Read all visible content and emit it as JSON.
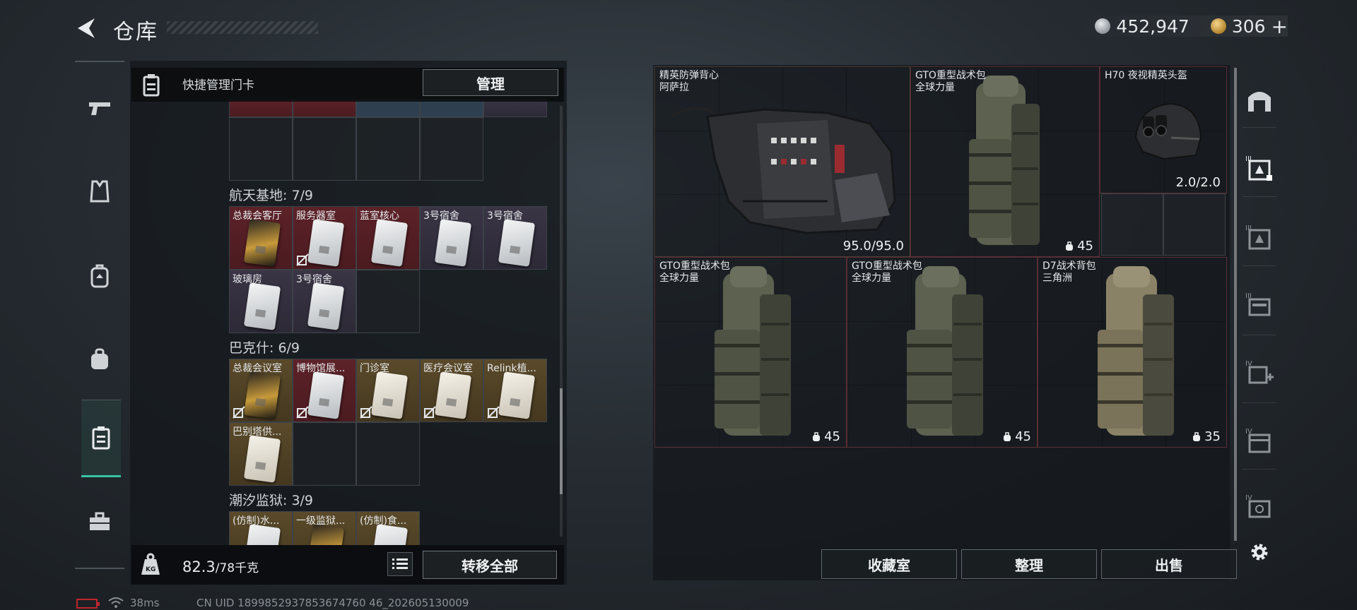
{
  "header": {
    "title": "仓库",
    "currency": [
      {
        "icon": "silver-coin-icon",
        "value": "452,947"
      },
      {
        "icon": "gold-coin-icon",
        "value": "306",
        "suffix": "+"
      }
    ]
  },
  "left_rail": {
    "items": [
      {
        "icon": "pistol-icon",
        "active": false
      },
      {
        "icon": "armor-vest-icon",
        "active": false
      },
      {
        "icon": "backpack-icon",
        "active": false
      },
      {
        "icon": "helmet-bag-icon",
        "active": false
      },
      {
        "icon": "keycard-holder-icon",
        "active": true
      },
      {
        "icon": "toolbox-icon",
        "active": false
      }
    ]
  },
  "left_panel": {
    "header_label": "快捷管理门卡",
    "manage_label": "管理",
    "sections": [
      {
        "title": "航天基地: 7/9",
        "cells": [
          {
            "label": "总裁会客厅",
            "color": "red",
            "card": "gold",
            "nolink": false
          },
          {
            "label": "服务器室",
            "color": "red",
            "card": "silver",
            "nolink": true
          },
          {
            "label": "蓝室核心",
            "color": "red",
            "card": "silver",
            "nolink": false
          },
          {
            "label": "3号宿舍",
            "color": "purple",
            "card": "silver",
            "nolink": false
          },
          {
            "label": "3号宿舍",
            "color": "purple",
            "card": "silver",
            "nolink": false
          },
          {
            "label": "玻璃房",
            "color": "purple",
            "card": "silver",
            "nolink": false
          },
          {
            "label": "3号宿舍",
            "color": "purple",
            "card": "silver",
            "nolink": false
          }
        ]
      },
      {
        "title": "巴克什: 6/9",
        "cells": [
          {
            "label": "总裁会议室",
            "color": "gold",
            "card": "gold",
            "nolink": true
          },
          {
            "label": "博物馆展...",
            "color": "red",
            "card": "silver",
            "nolink": true
          },
          {
            "label": "门诊室",
            "color": "gold",
            "card": "cream",
            "nolink": true
          },
          {
            "label": "医疗会议室",
            "color": "gold",
            "card": "cream",
            "nolink": true
          },
          {
            "label": "Relink植...",
            "color": "gold",
            "card": "cream",
            "nolink": true
          },
          {
            "label": "巴别塔供...",
            "color": "gold",
            "card": "cream",
            "nolink": false
          }
        ]
      },
      {
        "title": "潮汐监狱: 3/9",
        "cells": [
          {
            "label": "(仿制)水...",
            "color": "gold",
            "card": "silver",
            "nolink": false
          },
          {
            "label": "一级监狱...",
            "color": "gold",
            "card": "gold",
            "nolink": false
          },
          {
            "label": "(仿制)食...",
            "color": "gold",
            "card": "silver",
            "nolink": false
          }
        ]
      }
    ],
    "weight_value": "82.3",
    "weight_unit": "/78千克",
    "transfer_all_label": "转移全部"
  },
  "status_bar": {
    "ping": "38ms",
    "uid": "CN UID 1899852937853674760 46_202605130009"
  },
  "right_panel": {
    "items": [
      {
        "name_line1": "精英防弹背心",
        "name_line2": "阿萨拉",
        "value": "95.0/95.0",
        "type": "vest"
      },
      {
        "name_line1": "GTO重型战术包",
        "name_line2": "全球力量",
        "capacity": "45",
        "type": "backpack-green"
      },
      {
        "name_line1": "H70 夜视精英头盔",
        "name_line2": "",
        "value": "2.0/2.0",
        "type": "helmet"
      },
      {
        "name_line1": "GTO重型战术包",
        "name_line2": "全球力量",
        "capacity": "45",
        "type": "backpack-green"
      },
      {
        "name_line1": "GTO重型战术包",
        "name_line2": "全球力量",
        "capacity": "45",
        "type": "backpack-green"
      },
      {
        "name_line1": "D7战术背包",
        "name_line2": "三角洲",
        "capacity": "35",
        "type": "backpack-tan"
      }
    ],
    "actions": [
      "收藏室",
      "整理",
      "出售"
    ]
  },
  "right_rail": {
    "items": [
      {
        "icon": "arch-gate-icon",
        "tier": ""
      },
      {
        "icon": "stash-tier-III-icon",
        "tier": "III",
        "active": true
      },
      {
        "icon": "stash-tier-III-icon",
        "tier": "III"
      },
      {
        "icon": "stash-tier-III-icon",
        "tier": "III"
      },
      {
        "icon": "stash-tier-IV-plus-icon",
        "tier": "IV"
      },
      {
        "icon": "stash-tier-IV-icon",
        "tier": "IV"
      },
      {
        "icon": "stash-tier-IV-icon",
        "tier": "IV"
      },
      {
        "icon": "gear-icon",
        "tier": ""
      }
    ]
  },
  "colors": {
    "accent_teal": "#39c3a4",
    "rarity_red": "#5c2228",
    "rarity_purple": "#3a3545",
    "rarity_gold": "#5a4a2a"
  }
}
